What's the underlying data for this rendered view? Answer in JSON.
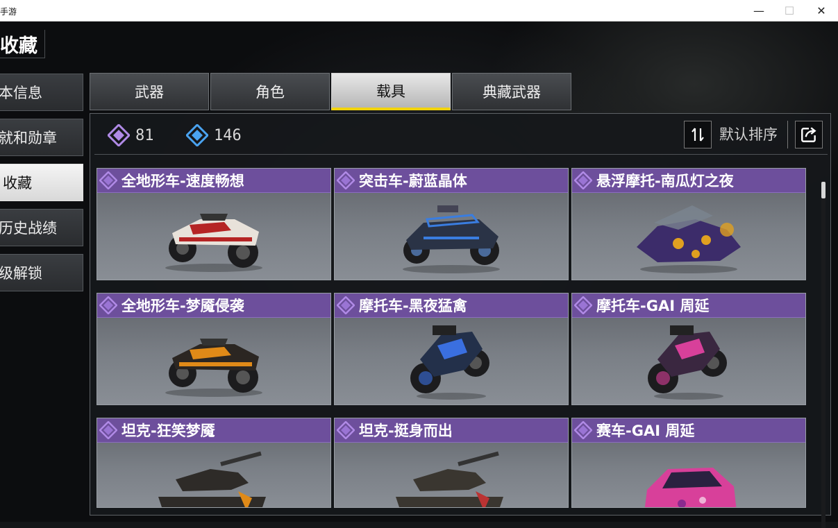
{
  "window": {
    "title": "手游",
    "minimize_glyph": "—",
    "maximize_glyph": "☐",
    "close_glyph": "✕"
  },
  "page": {
    "title": "收藏"
  },
  "sidebar": {
    "items": [
      {
        "label": "本信息",
        "active": false
      },
      {
        "label": "就和勋章",
        "active": false
      },
      {
        "label": "收藏",
        "active": true
      },
      {
        "label": "历史战绩",
        "active": false
      },
      {
        "label": "级解锁",
        "active": false
      }
    ]
  },
  "tabs": [
    {
      "label": "武器",
      "active": false
    },
    {
      "label": "角色",
      "active": false
    },
    {
      "label": "载具",
      "active": true
    },
    {
      "label": "典藏武器",
      "active": false
    }
  ],
  "stats": {
    "purple_count": "81",
    "blue_count": "146"
  },
  "toolbar": {
    "sort_label": "默认排序"
  },
  "colors": {
    "accent": "#f2d40c",
    "card_header": "#6d4f9c",
    "purple_gem": "#b08ae6",
    "blue_gem": "#4aa3f0"
  },
  "cards": [
    {
      "name": "全地形车-速度畅想",
      "vehicle": "atv",
      "body": "#e8e2da",
      "trim": "#b52424"
    },
    {
      "name": "突击车-蔚蓝晶体",
      "vehicle": "buggy",
      "body": "#2a3346",
      "trim": "#3a7de0"
    },
    {
      "name": "悬浮摩托-南瓜灯之夜",
      "vehicle": "hover",
      "body": "#3c2c6a",
      "trim": "#e0a020"
    },
    {
      "name": "全地形车-梦魇侵袭",
      "vehicle": "atv",
      "body": "#2b2622",
      "trim": "#e08a18"
    },
    {
      "name": "摩托车-黑夜猛禽",
      "vehicle": "moto",
      "body": "#23304a",
      "trim": "#3a6fe0"
    },
    {
      "name": "摩托车-GAI 周延",
      "vehicle": "moto",
      "body": "#3a2740",
      "trim": "#d8409a"
    },
    {
      "name": "坦克-狂笑梦魇",
      "vehicle": "tank",
      "body": "#2e2b28",
      "trim": "#e08a18"
    },
    {
      "name": "坦克-挺身而出",
      "vehicle": "tank",
      "body": "#3a3630",
      "trim": "#b33"
    },
    {
      "name": "赛车-GAI 周延",
      "vehicle": "car",
      "body": "#d8409a",
      "trim": "#8a2a8e"
    }
  ]
}
